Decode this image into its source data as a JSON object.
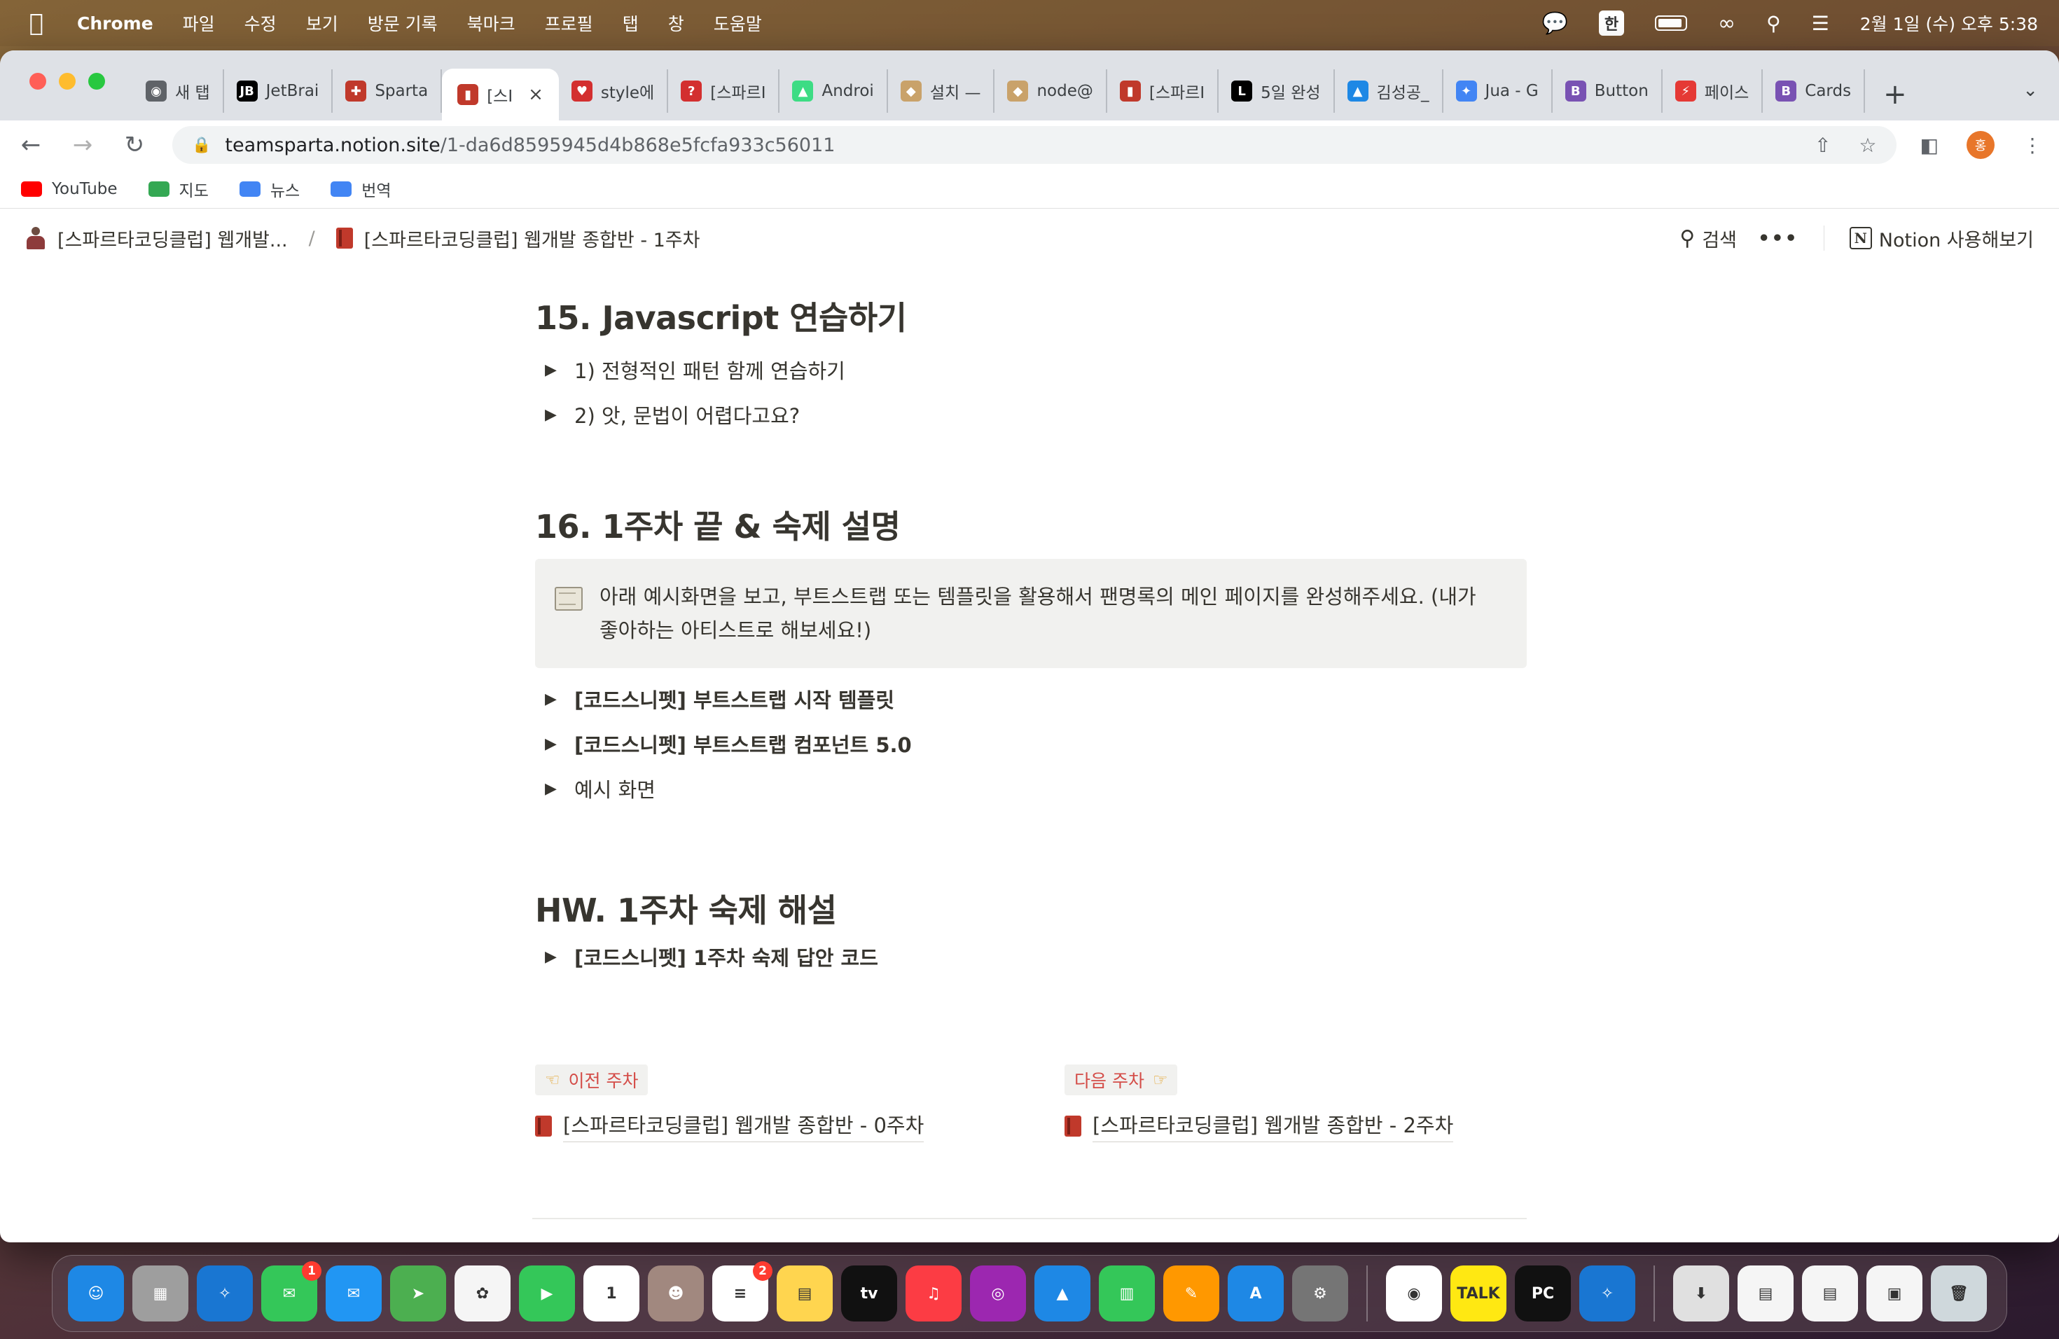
{
  "menubar": {
    "items": [
      "Chrome",
      "파일",
      "수정",
      "보기",
      "방문 기록",
      "북마크",
      "프로필",
      "탭",
      "창",
      "도움말"
    ],
    "ime": "한",
    "clock": "2월 1일 (수) 오후 5:38"
  },
  "tabs": [
    {
      "label": "새 탭",
      "color": "#5f6368",
      "glyph": "◉"
    },
    {
      "label": "JetBrai",
      "color": "#000000",
      "glyph": "JB"
    },
    {
      "label": "Sparta",
      "color": "#c0392b",
      "glyph": "✚"
    },
    {
      "label": "[스I",
      "color": "#c0392b",
      "glyph": "▮",
      "active": true
    },
    {
      "label": "style에",
      "color": "#d32f2f",
      "glyph": "♥"
    },
    {
      "label": "[스파르I",
      "color": "#d32f2f",
      "glyph": "?"
    },
    {
      "label": "Androi",
      "color": "#3ddc84",
      "glyph": "▲"
    },
    {
      "label": "설치 —",
      "color": "#c9a26a",
      "glyph": "◆"
    },
    {
      "label": "node@",
      "color": "#c9a26a",
      "glyph": "◆"
    },
    {
      "label": "[스파르I",
      "color": "#c0392b",
      "glyph": "▮"
    },
    {
      "label": "5일 완성",
      "color": "#000000",
      "glyph": "L"
    },
    {
      "label": "김성공_",
      "color": "#1e88e5",
      "glyph": "▲"
    },
    {
      "label": "Jua - G",
      "color": "#4285f4",
      "glyph": "✦"
    },
    {
      "label": "Button",
      "color": "#7952b3",
      "glyph": "B"
    },
    {
      "label": "페이스",
      "color": "#e53935",
      "glyph": "⚡"
    },
    {
      "label": "Cards",
      "color": "#7952b3",
      "glyph": "B"
    }
  ],
  "omnibox": {
    "host": "teamsparta.notion.site",
    "path": "/1-da6d8595945d4b868e5fcfa933c56011"
  },
  "profile_initial": "홍",
  "bookmarks": [
    {
      "label": "YouTube",
      "color": "#ff0000"
    },
    {
      "label": "지도",
      "color": "#34a853"
    },
    {
      "label": "뉴스",
      "color": "#4285f4"
    },
    {
      "label": "번역",
      "color": "#4285f4"
    }
  ],
  "notion_bar": {
    "crumb1": "[스파르타코딩클럽] 웹개발...",
    "crumb_sep": "/",
    "crumb2": "[스파르타코딩클럽] 웹개발 종합반 - 1주차",
    "search": "검색",
    "more": "•••",
    "try_notion": "Notion 사용해보기"
  },
  "page": {
    "sec15": {
      "title": "15. Javascript 연습하기",
      "toggles": [
        "1) 전형적인 패턴 함께 연습하기",
        "2) 앗, 문법이 어렵다고요?"
      ]
    },
    "sec16": {
      "title": "16. 1주차 끝 & 숙제 설명",
      "callout_line1": "아래 예시화면을 보고, 부트스트랩 또는 템플릿을 활용해서 팬명록의 메인 페이지를 완성해주세요. (내가",
      "callout_line2": "좋아하는 아티스트로 해보세요!)",
      "toggles": [
        "[코드스니펫] 부트스트랩 시작 템플릿",
        "[코드스니펫] 부트스트랩 컴포넌트 5.0",
        "예시 화면"
      ]
    },
    "hw": {
      "title": "HW. 1주차 숙제 해설",
      "toggles": [
        "[코드스니펫] 1주차 숙제 답안 코드"
      ]
    },
    "prev": {
      "tag": "이전  주차",
      "link": "[스파르타코딩클럽] 웹개발 종합반 - 0주차"
    },
    "next": {
      "tag": "다음  주차",
      "link": "[스파르타코딩클럽] 웹개발 종합반 - 2주차"
    }
  },
  "dock": [
    {
      "name": "finder",
      "color": "#1e88e5",
      "glyph": "☺"
    },
    {
      "name": "launchpad",
      "color": "#9e9e9e",
      "glyph": "▦"
    },
    {
      "name": "safari",
      "color": "#1976d2",
      "glyph": "✧"
    },
    {
      "name": "messages",
      "color": "#34c759",
      "glyph": "✉",
      "badge": "1"
    },
    {
      "name": "mail",
      "color": "#2196f3",
      "glyph": "✉"
    },
    {
      "name": "maps",
      "color": "#4caf50",
      "glyph": "➤"
    },
    {
      "name": "photos",
      "color": "#f5f5f5",
      "glyph": "✿"
    },
    {
      "name": "facetime",
      "color": "#34c759",
      "glyph": "▶"
    },
    {
      "name": "calendar",
      "color": "#ffffff",
      "glyph": "1"
    },
    {
      "name": "contacts",
      "color": "#a1887f",
      "glyph": "☻"
    },
    {
      "name": "reminders",
      "color": "#ffffff",
      "glyph": "≡",
      "badge": "2"
    },
    {
      "name": "notes",
      "color": "#ffd54f",
      "glyph": "▤"
    },
    {
      "name": "tv",
      "color": "#111111",
      "glyph": "tv"
    },
    {
      "name": "music",
      "color": "#fc3c44",
      "glyph": "♫"
    },
    {
      "name": "podcasts",
      "color": "#9c27b0",
      "glyph": "◎"
    },
    {
      "name": "keynote",
      "color": "#1e88e5",
      "glyph": "▲"
    },
    {
      "name": "numbers",
      "color": "#34c759",
      "glyph": "▥"
    },
    {
      "name": "pages",
      "color": "#ff9800",
      "glyph": "✎"
    },
    {
      "name": "app-store",
      "color": "#1e88e5",
      "glyph": "A"
    },
    {
      "name": "system-settings",
      "color": "#757575",
      "glyph": "⚙"
    },
    {
      "name": "chrome",
      "color": "#ffffff",
      "glyph": "◉"
    },
    {
      "name": "kakaotalk",
      "color": "#ffe812",
      "glyph": "TALK"
    },
    {
      "name": "pycharm",
      "color": "#111111",
      "glyph": "PC"
    },
    {
      "name": "safari-2",
      "color": "#1976d2",
      "glyph": "✧"
    },
    {
      "name": "downloads",
      "color": "#e0e0e0",
      "glyph": "⬇"
    },
    {
      "name": "doc-1",
      "color": "#f5f5f5",
      "glyph": "▤"
    },
    {
      "name": "doc-2",
      "color": "#f5f5f5",
      "glyph": "▤"
    },
    {
      "name": "doc-3",
      "color": "#f5f5f5",
      "glyph": "▣"
    },
    {
      "name": "trash",
      "color": "#cfd8dc",
      "glyph": "🗑"
    }
  ]
}
